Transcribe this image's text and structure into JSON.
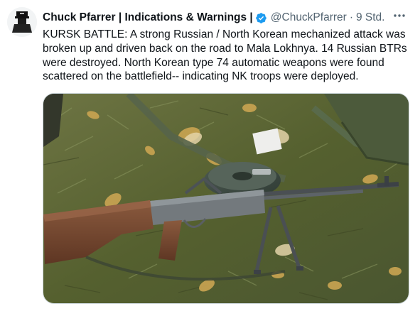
{
  "tweet": {
    "display_name": "Chuck Pfarrer | Indications & Warnings |",
    "handle": "@ChuckPfarrer",
    "separator": "·",
    "timestamp": "9 Std.",
    "text_lines": [
      "KURSK BATTLE:  A strong Russian / North Korean mechanized attack was",
      "broken up and driven back on the road to Mala Lokhnya.   14 Russian BTRs",
      "were destroyed.  North Korean type 74 automatic weapons were found",
      "scattered on the battlefield-- indicating NK troops were deployed."
    ],
    "verified_color": "#1d9bf0",
    "icons": {
      "avatar": "avatar-icon",
      "verified": "verified-badge-icon",
      "more": "more-options-icon"
    }
  },
  "media": {
    "description_icon": "photo",
    "colors": {
      "ground": "#5f6a3a",
      "leaves": "#c9a24a",
      "stock": "#7a4a32",
      "metal": "#6f757a",
      "magazine": "#3d4a44"
    }
  }
}
